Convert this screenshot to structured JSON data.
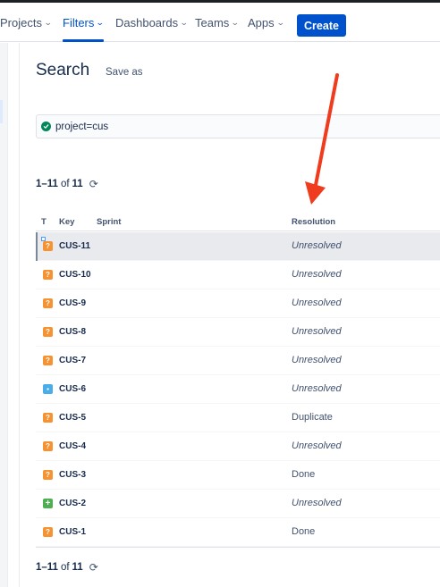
{
  "nav": {
    "items": [
      {
        "label": "Projects",
        "active": false
      },
      {
        "label": "Filters",
        "active": true
      },
      {
        "label": "Dashboards",
        "active": false
      },
      {
        "label": "Teams",
        "active": false
      },
      {
        "label": "Apps",
        "active": false
      }
    ],
    "create_label": "Create"
  },
  "search": {
    "title": "Search",
    "save_as": "Save as",
    "jql": "project=cus"
  },
  "pager": {
    "range": "1–11",
    "of": "of",
    "total": "11"
  },
  "table": {
    "columns": {
      "type": "T",
      "key": "Key",
      "sprint": "Sprint",
      "resolution": "Resolution"
    },
    "rows": [
      {
        "key": "CUS-11",
        "type": "question-icon",
        "resolution": "Unresolved",
        "selected": true
      },
      {
        "key": "CUS-10",
        "type": "question-icon",
        "resolution": "Unresolved"
      },
      {
        "key": "CUS-9",
        "type": "question-icon",
        "resolution": "Unresolved"
      },
      {
        "key": "CUS-8",
        "type": "question-icon",
        "resolution": "Unresolved"
      },
      {
        "key": "CUS-7",
        "type": "question-icon",
        "resolution": "Unresolved"
      },
      {
        "key": "CUS-6",
        "type": "story-icon",
        "resolution": "Unresolved"
      },
      {
        "key": "CUS-5",
        "type": "question-icon",
        "resolution": "Duplicate"
      },
      {
        "key": "CUS-4",
        "type": "question-icon",
        "resolution": "Unresolved"
      },
      {
        "key": "CUS-3",
        "type": "question-icon",
        "resolution": "Done"
      },
      {
        "key": "CUS-2",
        "type": "new-feature-icon",
        "resolution": "Unresolved"
      },
      {
        "key": "CUS-1",
        "type": "question-icon",
        "resolution": "Done"
      }
    ]
  },
  "colors": {
    "accent": "#0052cc",
    "annotation_arrow": "#f03c1e",
    "question_icon": "#f79232",
    "story_icon": "#4bade8",
    "new_feature_icon": "#4caf50"
  }
}
